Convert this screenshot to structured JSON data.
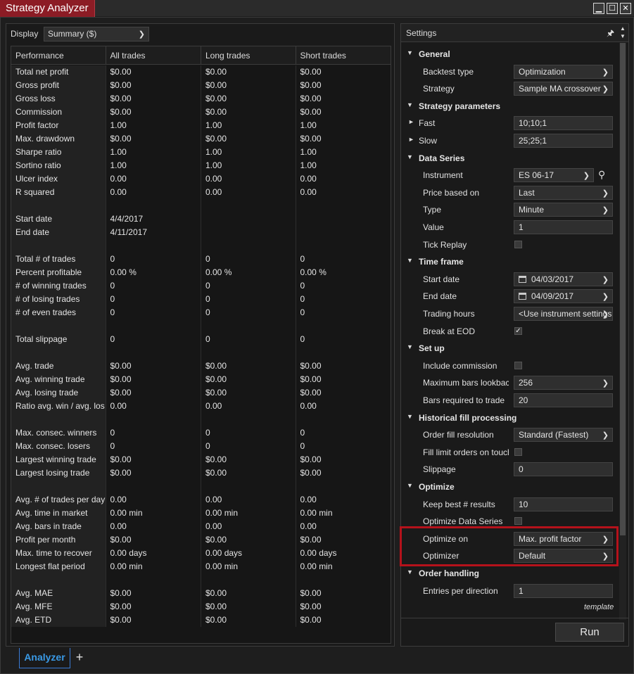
{
  "window": {
    "title": "Strategy Analyzer",
    "controls": {
      "minimize": "▁",
      "maximize": "☐",
      "close": "✕"
    }
  },
  "display": {
    "label": "Display",
    "value": "Summary ($)"
  },
  "performance": {
    "headers": [
      "Performance",
      "All trades",
      "Long trades",
      "Short trades"
    ],
    "rows": [
      [
        "Total net profit",
        "$0.00",
        "$0.00",
        "$0.00"
      ],
      [
        "Gross profit",
        "$0.00",
        "$0.00",
        "$0.00"
      ],
      [
        "Gross loss",
        "$0.00",
        "$0.00",
        "$0.00"
      ],
      [
        "Commission",
        "$0.00",
        "$0.00",
        "$0.00"
      ],
      [
        "Profit factor",
        "1.00",
        "1.00",
        "1.00"
      ],
      [
        "Max. drawdown",
        "$0.00",
        "$0.00",
        "$0.00"
      ],
      [
        "Sharpe ratio",
        "1.00",
        "1.00",
        "1.00"
      ],
      [
        "Sortino ratio",
        "1.00",
        "1.00",
        "1.00"
      ],
      [
        "Ulcer index",
        "0.00",
        "0.00",
        "0.00"
      ],
      [
        "R squared",
        "0.00",
        "0.00",
        "0.00"
      ],
      [
        "",
        "",
        "",
        ""
      ],
      [
        "Start date",
        "4/4/2017",
        "",
        ""
      ],
      [
        "End date",
        "4/11/2017",
        "",
        ""
      ],
      [
        "",
        "",
        "",
        ""
      ],
      [
        "Total # of trades",
        "0",
        "0",
        "0"
      ],
      [
        "Percent profitable",
        "0.00 %",
        "0.00 %",
        "0.00 %"
      ],
      [
        "# of winning trades",
        "0",
        "0",
        "0"
      ],
      [
        "# of losing trades",
        "0",
        "0",
        "0"
      ],
      [
        "# of even trades",
        "0",
        "0",
        "0"
      ],
      [
        "",
        "",
        "",
        ""
      ],
      [
        "Total slippage",
        "0",
        "0",
        "0"
      ],
      [
        "",
        "",
        "",
        ""
      ],
      [
        "Avg. trade",
        "$0.00",
        "$0.00",
        "$0.00"
      ],
      [
        "Avg. winning trade",
        "$0.00",
        "$0.00",
        "$0.00"
      ],
      [
        "Avg. losing trade",
        "$0.00",
        "$0.00",
        "$0.00"
      ],
      [
        "Ratio avg. win / avg. los",
        "0.00",
        "0.00",
        "0.00"
      ],
      [
        "",
        "",
        "",
        ""
      ],
      [
        "Max. consec. winners",
        "0",
        "0",
        "0"
      ],
      [
        "Max. consec. losers",
        "0",
        "0",
        "0"
      ],
      [
        "Largest winning trade",
        "$0.00",
        "$0.00",
        "$0.00"
      ],
      [
        "Largest losing trade",
        "$0.00",
        "$0.00",
        "$0.00"
      ],
      [
        "",
        "",
        "",
        ""
      ],
      [
        "Avg. # of trades per day",
        "0.00",
        "0.00",
        "0.00"
      ],
      [
        "Avg. time in market",
        "0.00 min",
        "0.00 min",
        "0.00 min"
      ],
      [
        "Avg. bars in trade",
        "0.00",
        "0.00",
        "0.00"
      ],
      [
        "Profit per month",
        "$0.00",
        "$0.00",
        "$0.00"
      ],
      [
        "Max. time to recover",
        "0.00 days",
        "0.00 days",
        "0.00 days"
      ],
      [
        "Longest flat period",
        "0.00 min",
        "0.00 min",
        "0.00 min"
      ],
      [
        "",
        "",
        "",
        ""
      ],
      [
        "Avg. MAE",
        "$0.00",
        "$0.00",
        "$0.00"
      ],
      [
        "Avg. MFE",
        "$0.00",
        "$0.00",
        "$0.00"
      ],
      [
        "Avg. ETD",
        "$0.00",
        "$0.00",
        "$0.00"
      ]
    ]
  },
  "settings": {
    "title": "Settings",
    "rows": [
      {
        "kind": "category",
        "label": "General"
      },
      {
        "kind": "select",
        "label": "Backtest type",
        "value": "Optimization"
      },
      {
        "kind": "select",
        "label": "Strategy",
        "value": "Sample MA crossover"
      },
      {
        "kind": "category",
        "label": "Strategy parameters"
      },
      {
        "kind": "sub",
        "label": "Fast",
        "value": "10;10;1"
      },
      {
        "kind": "sub",
        "label": "Slow",
        "value": "25;25;1"
      },
      {
        "kind": "category",
        "label": "Data Series"
      },
      {
        "kind": "instrument",
        "label": "Instrument",
        "value": "ES 06-17"
      },
      {
        "kind": "select",
        "label": "Price based on",
        "value": "Last"
      },
      {
        "kind": "select",
        "label": "Type",
        "value": "Minute"
      },
      {
        "kind": "text",
        "label": "Value",
        "value": "1"
      },
      {
        "kind": "check",
        "label": "Tick Replay",
        "checked": false
      },
      {
        "kind": "category",
        "label": "Time frame"
      },
      {
        "kind": "date",
        "label": "Start date",
        "value": "04/03/2017"
      },
      {
        "kind": "date",
        "label": "End date",
        "value": "04/09/2017"
      },
      {
        "kind": "select",
        "label": "Trading hours",
        "value": "<Use instrument settings>"
      },
      {
        "kind": "check",
        "label": "Break at EOD",
        "checked": true
      },
      {
        "kind": "category",
        "label": "Set up"
      },
      {
        "kind": "check",
        "label": "Include commission",
        "checked": false
      },
      {
        "kind": "select",
        "label": "Maximum bars lookback",
        "value": "256"
      },
      {
        "kind": "text",
        "label": "Bars required to trade",
        "value": "20"
      },
      {
        "kind": "category",
        "label": "Historical fill processing"
      },
      {
        "kind": "select",
        "label": "Order fill resolution",
        "value": "Standard (Fastest)"
      },
      {
        "kind": "check",
        "label": "Fill limit orders on touch",
        "checked": false
      },
      {
        "kind": "text",
        "label": "Slippage",
        "value": "0"
      },
      {
        "kind": "category",
        "label": "Optimize"
      },
      {
        "kind": "text",
        "label": "Keep best # results",
        "value": "10"
      },
      {
        "kind": "check",
        "label": "Optimize Data Series",
        "checked": false
      },
      {
        "kind": "select",
        "label": "Optimize on",
        "value": "Max. profit factor"
      },
      {
        "kind": "select",
        "label": "Optimizer",
        "value": "Default"
      },
      {
        "kind": "category",
        "label": "Order handling"
      },
      {
        "kind": "text",
        "label": "Entries per direction",
        "value": "1"
      }
    ],
    "template_label": "template",
    "run_label": "Run"
  },
  "tabs": {
    "active": "Analyzer",
    "add": "+"
  },
  "colors": {
    "accent": "#8c1c25",
    "highlight": "#b5121b",
    "tab_active": "#3a9ae6"
  }
}
